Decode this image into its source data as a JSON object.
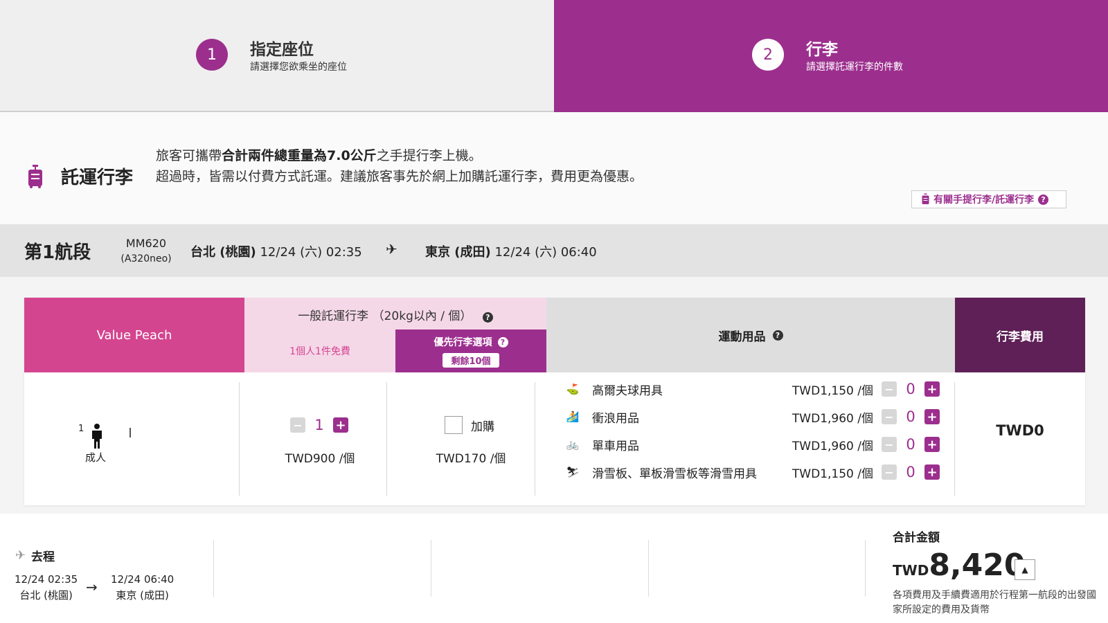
{
  "steps": [
    {
      "num": "1",
      "title": "指定座位",
      "subtitle": "請選擇您欲乘坐的座位"
    },
    {
      "num": "2",
      "title": "行李",
      "subtitle": "請選擇託運行李的件數"
    }
  ],
  "info": {
    "title": "託運行李",
    "line1_pre": "旅客可攜帶",
    "line1_bold": "合計兩件總重量為7.0公斤",
    "line1_post": "之手提行李上機。",
    "line2": "超過時，皆需以付費方式託運。建議旅客事先於網上加購託運行李，費用更為優惠。",
    "link_label": "有關手提行李/託運行李",
    "qmark": "?"
  },
  "segment": {
    "label": "第1航段",
    "flight_no": "MM620",
    "aircraft": "(A320neo)",
    "from_city": "台北 (桃園)",
    "from_time": "12/24 (六) 02:35",
    "to_city": "東京 (成田)",
    "to_time": "12/24 (六) 06:40",
    "plane_glyph": "✈"
  },
  "table": {
    "fare_header": "Value Peach",
    "general_header": "一般託運行李 （20kg以內 / 個）",
    "free_label": "1個人1件免費",
    "priority_header": "優先行李選項",
    "priority_remaining": "剩餘10個",
    "sport_header": "運動用品",
    "fee_header": "行李費用",
    "passenger": {
      "count": "1",
      "label": "成人"
    },
    "general": {
      "minus": "−",
      "plus": "+",
      "value": "1",
      "price": "TWD900 /個"
    },
    "priority": {
      "checkbox_label": "加購",
      "price": "TWD170 /個"
    },
    "sports": [
      {
        "icon": "golf-icon",
        "glyph": "⛳",
        "name": "高爾夫球用具",
        "price": "TWD1,150 /個",
        "value": "0"
      },
      {
        "icon": "surf-icon",
        "glyph": "🏄",
        "name": "衝浪用品",
        "price": "TWD1,960 /個",
        "value": "0"
      },
      {
        "icon": "bicycle-icon",
        "glyph": "🚲",
        "name": "單車用品",
        "price": "TWD1,960 /個",
        "value": "0"
      },
      {
        "icon": "ski-icon",
        "glyph": "⛷",
        "name": "滑雪板、單板滑雪板等滑雪用具",
        "price": "TWD1,150 /個",
        "value": "0"
      }
    ],
    "fee_total": "TWD0"
  },
  "footer": {
    "trip_title": "去程",
    "dep_time": "12/24 02:35",
    "dep_city": "台北 (桃園)",
    "arr_time": "12/24 06:40",
    "arr_city": "東京 (成田)",
    "arrow": "→",
    "total_label": "合計金額",
    "currency": "TWD",
    "total": "8,420",
    "toggle_glyph": "▲",
    "note": "各項費用及手續費適用於行程第一航段的出發國家所設定的費用及貨幣"
  },
  "colors": {
    "brand": "#9c2f8e",
    "pink": "#d4458f",
    "dark": "#5e2056"
  }
}
